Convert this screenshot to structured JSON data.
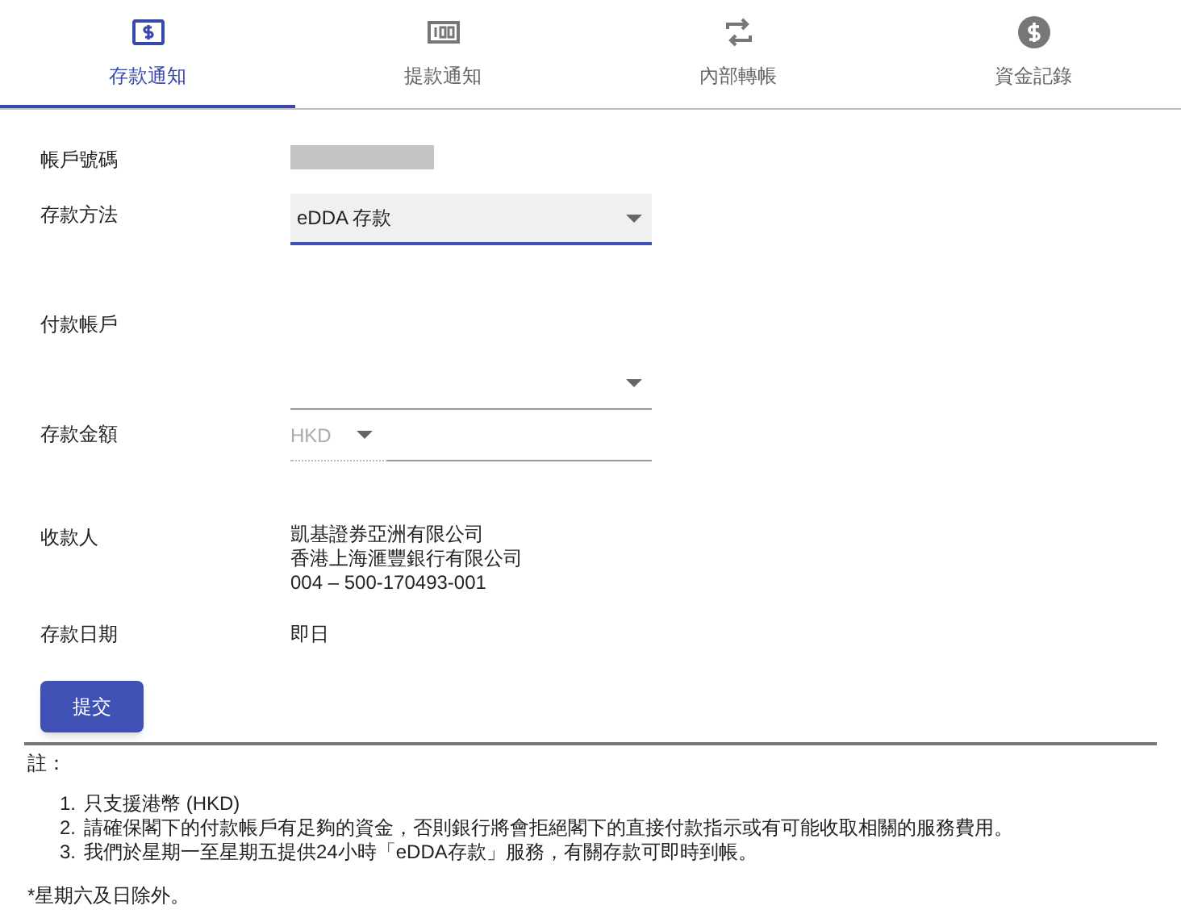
{
  "tabs": [
    {
      "label": "存款通知",
      "selected": true
    },
    {
      "label": "提款通知",
      "selected": false
    },
    {
      "label": "內部轉帳",
      "selected": false
    },
    {
      "label": "資金記錄",
      "selected": false
    }
  ],
  "form": [
    {
      "kind": "masked",
      "label": "帳戶號碼"
    },
    {
      "kind": "select",
      "label": "存款方法",
      "value": "eDDA 存款",
      "focused": true
    },
    {
      "kind": "select",
      "label": "付款帳戶",
      "focused": false
    },
    {
      "kind": "amount",
      "label": "存款金額",
      "currency": "HKD"
    },
    {
      "kind": "lines",
      "label": "收款人",
      "lines": [
        "凱基證券亞洲有限公司",
        "香港上海滙豐銀行有限公司",
        "004 – 500-170493-001"
      ]
    },
    {
      "kind": "text",
      "label": "存款日期",
      "value": "即日"
    }
  ],
  "submit_button": "提交",
  "notes": {
    "title": "註：",
    "items": [
      {
        "number": "1.",
        "text": "只支援港幣 (HKD)"
      },
      {
        "number": "2.",
        "text": "請確保閣下的付款帳戶有足夠的資金，否則銀行將會拒絕閣下的直接付款指示或有可能收取相關的服務費用。"
      },
      {
        "number": "3.",
        "text": "我們於星期一至星期五提供24小時「eDDA存款」服務，有關存款可即時到帳。"
      }
    ],
    "footnote": "*星期六及日除外。"
  }
}
